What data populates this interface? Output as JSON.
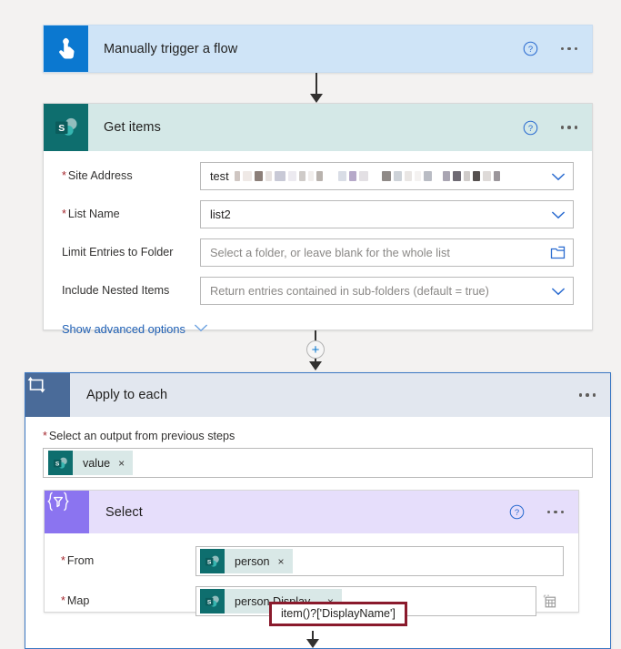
{
  "trigger": {
    "title": "Manually trigger a flow",
    "icon": "tap-hand-icon",
    "icon_color": "#0b78d0",
    "header_color": "#cfe4f7",
    "help_label": "?",
    "more_label": "..."
  },
  "get_items": {
    "title": "Get items",
    "icon": "sharepoint-icon",
    "icon_color": "#0e6e6e",
    "header_color": "#d4e8e7",
    "fields": [
      {
        "label": "Site Address",
        "required": true,
        "value": "test",
        "redacted": true,
        "placeholder": "",
        "affix": "chevron-down-icon"
      },
      {
        "label": "List Name",
        "required": true,
        "value": "list2",
        "redacted": false,
        "placeholder": "",
        "affix": "chevron-down-icon"
      },
      {
        "label": "Limit Entries to Folder",
        "required": false,
        "value": "",
        "redacted": false,
        "placeholder": "Select a folder, or leave blank for the whole list",
        "affix": "folder-picker-icon"
      },
      {
        "label": "Include Nested Items",
        "required": false,
        "value": "",
        "redacted": false,
        "placeholder": "Return entries contained in sub-folders (default = true)",
        "affix": "chevron-down-icon"
      }
    ],
    "advanced_link": "Show advanced options"
  },
  "connector": {
    "add_step_label": "+"
  },
  "apply_to_each": {
    "title": "Apply to each",
    "icon": "loop-icon",
    "icon_color": "#4a6b99",
    "header_color": "#e2e7ef",
    "more_label": "...",
    "output_label": "Select an output from previous steps",
    "output_required": true,
    "token": {
      "label": "value",
      "icon": "sharepoint-icon",
      "remove": "×"
    }
  },
  "select": {
    "title": "Select",
    "icon": "select-filter-icon",
    "icon_color": "#8b74f0",
    "header_color": "#e6defb",
    "help_label": "?",
    "more_label": "...",
    "rows": [
      {
        "label": "From",
        "required": true,
        "token": {
          "label": "person",
          "icon": "sharepoint-icon",
          "remove": "×"
        },
        "affix": ""
      },
      {
        "label": "Map",
        "required": true,
        "token": {
          "label": "person Display...",
          "icon": "sharepoint-icon",
          "remove": "×"
        },
        "affix": "text-mode-icon"
      }
    ]
  },
  "tooltip": {
    "text": "item()?['DisplayName']",
    "border_color": "#8a1a2c"
  }
}
